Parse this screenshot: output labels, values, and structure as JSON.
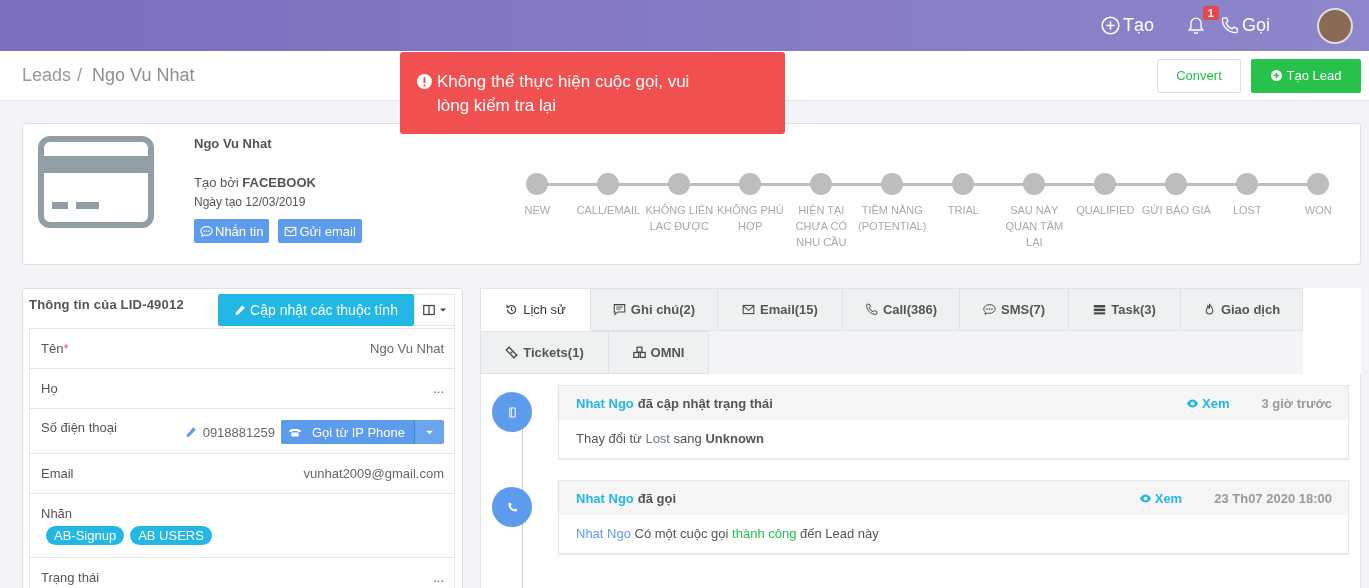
{
  "topbar": {
    "create": "Tạo",
    "notifications": "1",
    "call": "Gọi"
  },
  "breadcrumb": {
    "root": "Leads",
    "separator": "/",
    "current": "Ngo Vu Nhat"
  },
  "header_buttons": {
    "convert": "Convert",
    "create_lead": "Tạo Lead"
  },
  "toast": {
    "message": "Không thể thực hiện cuộc gọi, vui lòng kiểm tra lại"
  },
  "lead": {
    "name": "Ngo Vu Nhat",
    "created_by": "Tạo bởi **FACEBOOK**",
    "created_date": "Ngày tạo 12/03/2019",
    "actions": [
      "Nhắn tin",
      "Gửi email"
    ]
  },
  "stages": [
    "NEW",
    "CALL/EMAIL",
    "KHÔNG LIÊN LẠC ĐƯỢC",
    "KHÔNG PHÙ HỢP",
    "HIỆN TẠI CHƯA CÓ NHU CẦU",
    "TIỀM NĂNG (POTENTIAL)",
    "TRIAL",
    "SAU NÀY QUAN TÂM LẠI",
    "QUALIFIED",
    "GỬI BÁO GIÁ",
    "LOST",
    "WON"
  ],
  "info_panel": {
    "title": "Thông tin của LID-49012",
    "update_button": "Cập nhật các thuộc tính",
    "required_mark": "*",
    "fields": [
      {
        "kind": "text",
        "label": "Tên",
        "required": true,
        "value": "Ngo Vu Nhat"
      },
      {
        "kind": "text",
        "label": "Họ",
        "required": false,
        "value": "..."
      },
      {
        "kind": "phone",
        "label": "Số điện thoại",
        "required": false,
        "value": "0918881259",
        "button": "Gọi từ IP Phone"
      },
      {
        "kind": "text",
        "label": "Email",
        "required": false,
        "value": "vunhat2009@gmail.com"
      },
      {
        "kind": "tags",
        "label": "Nhãn",
        "required": false,
        "tags": [
          "AB-Signup",
          "AB USERS"
        ]
      },
      {
        "kind": "text",
        "label": "Trạng thái",
        "required": false,
        "value": "..."
      }
    ]
  },
  "tabs": [
    {
      "label": "Lịch sử",
      "selected": true
    },
    {
      "label": "Ghi chú(2)",
      "selected": false
    },
    {
      "label": "Email(15)",
      "selected": false
    },
    {
      "label": "Call(386)",
      "selected": false
    },
    {
      "label": "SMS(7)",
      "selected": false
    },
    {
      "label": "Task(3)",
      "selected": false
    },
    {
      "label": "Giao dịch",
      "selected": false
    },
    {
      "label": "Tickets(1)",
      "selected": false
    },
    {
      "label": "OMNI",
      "selected": false
    }
  ],
  "timeline": [
    {
      "kind": "status",
      "actor": "Nhat Ngo",
      "action": "đã cập nhật trạng thái",
      "view": "Xem",
      "time": "3 giờ trước",
      "body": [
        {
          "kind": "plain",
          "text": "Thay đổi từ "
        },
        {
          "kind": "muted",
          "text": "Lost"
        },
        {
          "kind": "plain",
          "text": " sang "
        },
        {
          "kind": "bold",
          "text": "Unknown"
        }
      ]
    },
    {
      "kind": "call",
      "actor": "Nhat Ngo",
      "action": "đã gọi",
      "view": "Xem",
      "time": "23 Th07 2020 18:00",
      "body": [
        {
          "kind": "link",
          "text": "Nhat Ngo"
        },
        {
          "kind": "plain",
          "text": " Có một cuộc gọi "
        },
        {
          "kind": "success",
          "text": "thành công"
        },
        {
          "kind": "plain",
          "text": " đến Lead này"
        }
      ]
    }
  ]
}
